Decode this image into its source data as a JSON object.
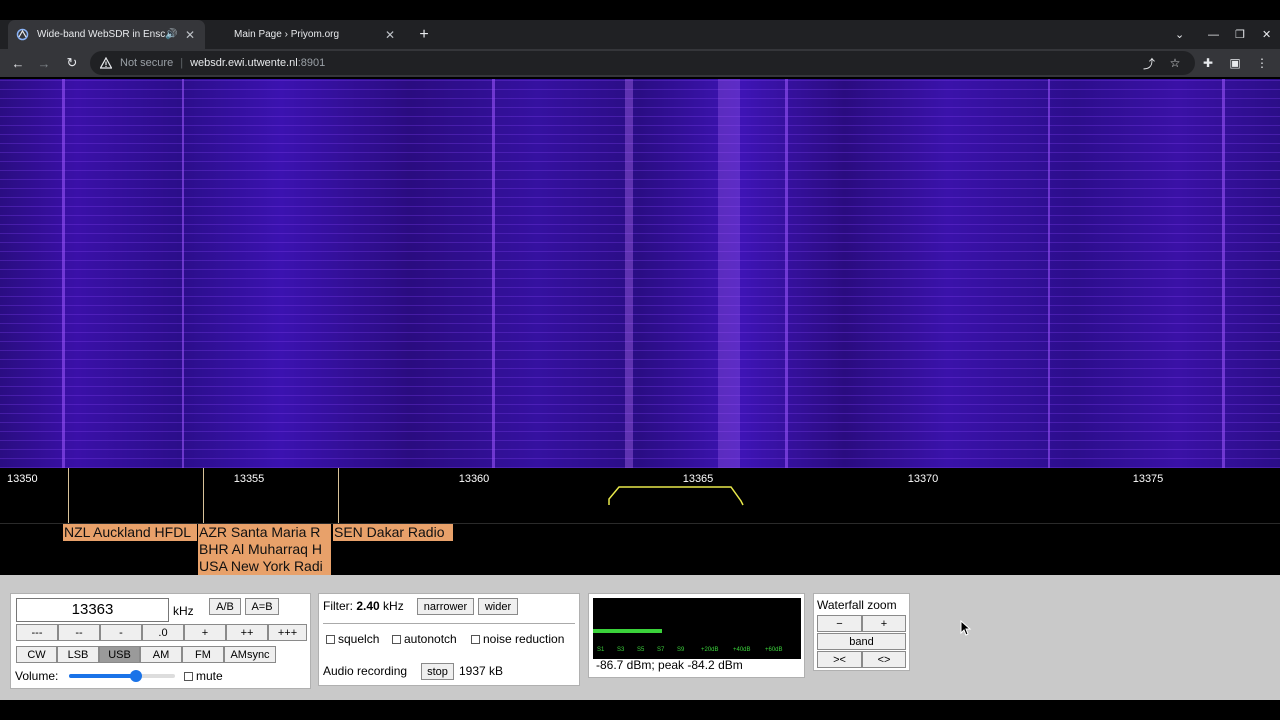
{
  "browser": {
    "tabs": [
      {
        "title": "Wide-band WebSDR in Ensch",
        "active": true,
        "audio": true
      },
      {
        "title": "Main Page › Priyom.org",
        "active": false,
        "audio": false
      }
    ],
    "new_tab": "+",
    "url_warning": "Not secure",
    "url_host": "websdr.ewi.utwente.nl",
    "url_port": ":8901"
  },
  "scale": {
    "ticks": [
      "13350",
      "13355",
      "13360",
      "13365",
      "13370",
      "13375"
    ],
    "tick_values_khz": [
      13350,
      13355,
      13360,
      13365,
      13370,
      13375
    ]
  },
  "stations": [
    {
      "label": "NZL Auckland HFDL"
    },
    {
      "label": "AZR Santa Maria R"
    },
    {
      "label": "BHR Al Muharraq H"
    },
    {
      "label": "USA New York Radi"
    },
    {
      "label": "SEN Dakar Radio"
    }
  ],
  "controls": {
    "frequency": "13363",
    "unit": "kHz",
    "ab": "A/B",
    "aeqb": "A=B",
    "step_buttons": [
      "---",
      "--",
      "-",
      ".0",
      "+",
      "++",
      "+++"
    ],
    "modes": [
      "CW",
      "LSB",
      "USB",
      "AM",
      "FM",
      "AMsync"
    ],
    "active_mode": "USB",
    "volume_label": "Volume:",
    "volume_level": 0.63,
    "mute_label": "mute"
  },
  "filter": {
    "label": "Filter:",
    "value": "2.40",
    "unit": "kHz",
    "narrower": "narrower",
    "wider": "wider",
    "squelch": "squelch",
    "autonotch": "autonotch",
    "noise_reduction": "noise reduction",
    "audio_recording": "Audio recording",
    "stop": "stop",
    "size": "1937 kB"
  },
  "meter": {
    "scale": [
      "S1",
      "S3",
      "S5",
      "S7",
      "S9",
      "+20dB",
      "+40dB",
      "+60dB"
    ],
    "level_fraction": 0.33,
    "reading": "-86.7 dBm; peak  -84.2 dBm"
  },
  "zoom": {
    "title": "Waterfall zoom",
    "minus": "−",
    "plus": "+",
    "band": "band",
    "narrow": "><",
    "widen": "<>"
  },
  "colors": {
    "waterfall": "#2a0d82",
    "station_label": "#e8a16a",
    "meter_green": "#3bd23b",
    "passband_yellow": "#e8e84a"
  }
}
